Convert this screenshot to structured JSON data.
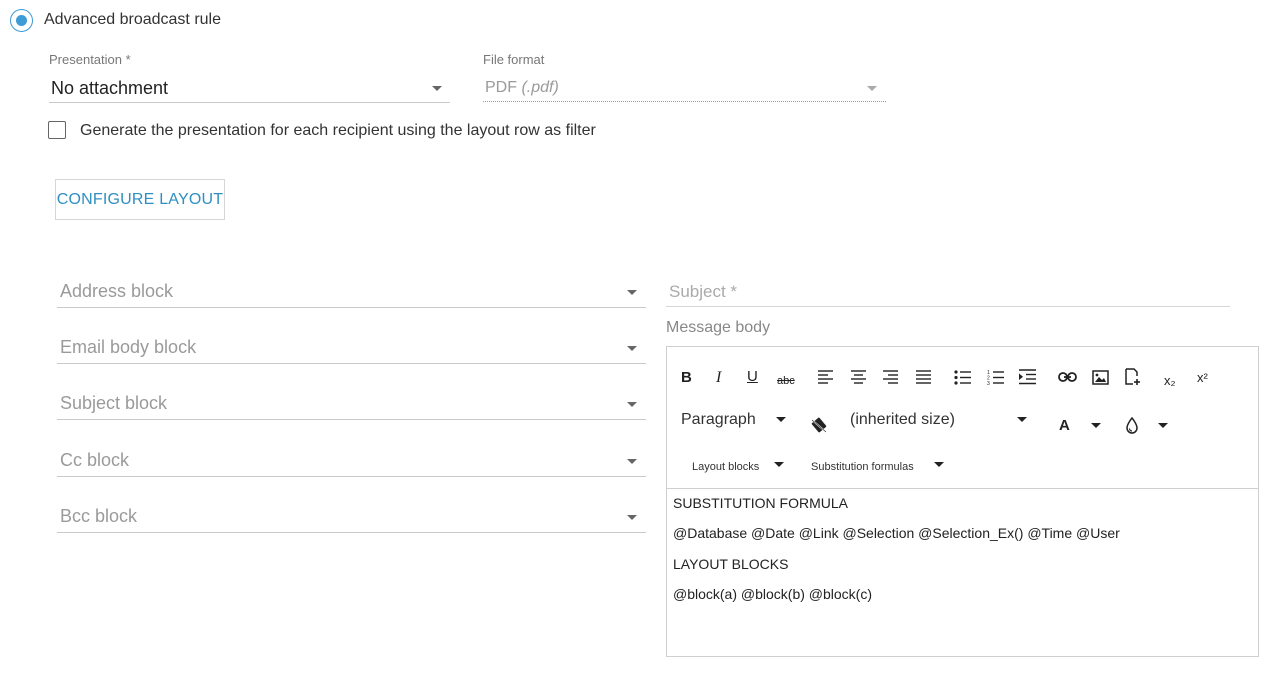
{
  "rule": {
    "radio_label": "Advanced broadcast rule"
  },
  "presentation": {
    "label": "Presentation *",
    "value": "No attachment"
  },
  "file_format": {
    "label": "File format",
    "value_main": "PDF",
    "value_ext": "(.pdf)"
  },
  "generate_checkbox": {
    "label": "Generate the presentation for each recipient using the layout row as filter",
    "checked": false
  },
  "configure_button": {
    "label": "CONFIGURE LAYOUT"
  },
  "blocks": {
    "address": "Address block",
    "email_body": "Email body block",
    "subject": "Subject block",
    "cc": "Cc block",
    "bcc": "Bcc block"
  },
  "subject_field": {
    "placeholder": "Subject *"
  },
  "message_body": {
    "label": "Message body"
  },
  "editor_toolbar": {
    "bold": "B",
    "italic": "I",
    "underline": "U",
    "strikethrough": "abc",
    "paragraph": "Paragraph",
    "font_size": "(inherited size)",
    "font_color": "A",
    "layout_blocks": "Layout blocks",
    "substitution_formulas": "Substitution formulas",
    "subscript": "x₂",
    "superscript": "x²"
  },
  "editor_content": {
    "line1": "SUBSTITUTION FORMULA",
    "line2": "@Database @Date @Link @Selection @Selection_Ex() @Time @User",
    "line3": "LAYOUT BLOCKS",
    "line4": "@block(a) @block(b) @block(c)"
  },
  "colors": {
    "accent": "#3d9bd6",
    "button_text": "#2f8fc2"
  }
}
